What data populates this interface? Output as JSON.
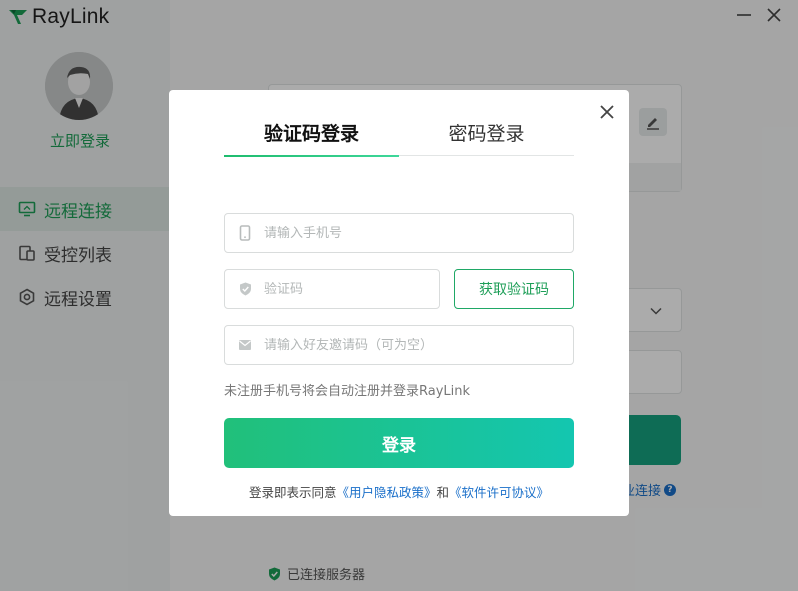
{
  "app": {
    "logo_text": "RayLink",
    "login_link": "立即登录",
    "nav": [
      {
        "label": "远程连接",
        "icon": "monitor-icon",
        "active": true
      },
      {
        "label": "受控列表",
        "icon": "devices-icon",
        "active": false
      },
      {
        "label": "远程设置",
        "icon": "hexagon-settings-icon",
        "active": false
      }
    ],
    "enterprise_link": "业连接",
    "status_text": "已连接服务器",
    "colors": {
      "brand_green": "#1d9e57",
      "link_blue": "#1a6fc9",
      "connect_teal": "#16a17f"
    }
  },
  "modal": {
    "tabs": [
      {
        "label": "验证码登录",
        "active": true
      },
      {
        "label": "密码登录",
        "active": false
      }
    ],
    "phone_placeholder": "请输入手机号",
    "code_placeholder": "验证码",
    "get_code_label": "获取验证码",
    "invite_placeholder": "请输入好友邀请码（可为空）",
    "hint": "未注册手机号将会自动注册并登录RayLink",
    "login_label": "登录",
    "agree_prefix": "登录即表示同意",
    "privacy_link": "《用户隐私政策》",
    "agree_and": "和",
    "license_link": "《软件许可协议》",
    "colors": {
      "login_gradient_start": "#21c07a",
      "login_gradient_end": "#14c6b0"
    }
  }
}
